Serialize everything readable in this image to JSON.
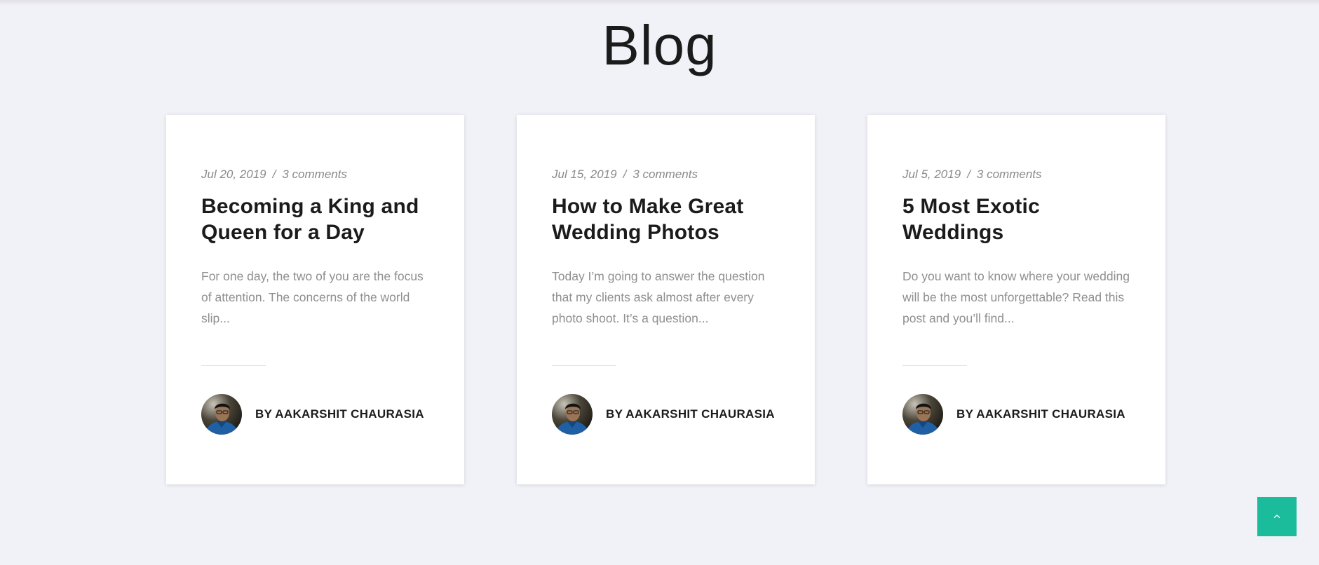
{
  "page": {
    "title": "Blog"
  },
  "posts": [
    {
      "date": "Jul 20, 2019",
      "separator": "/",
      "comments": "3 comments",
      "title": "Becoming a King and Queen for a Day",
      "excerpt": "For one day, the two of you are the focus of attention. The concerns of the world slip...",
      "author": "BY AAKARSHIT CHAURASIA"
    },
    {
      "date": "Jul 15, 2019",
      "separator": "/",
      "comments": "3 comments",
      "title": "How to Make Great Wedding Photos",
      "excerpt": "Today I’m going to answer the question that my clients ask almost after every photo shoot. It’s a question...",
      "author": "BY AAKARSHIT CHAURASIA"
    },
    {
      "date": "Jul 5, 2019",
      "separator": "/",
      "comments": "3 comments",
      "title": "5 Most Exotic Weddings",
      "excerpt": "Do you want to know where your wedding will be the most unforgettable? Read this post and you’ll find...",
      "author": "BY AAKARSHIT CHAURASIA"
    }
  ],
  "back_to_top": {
    "icon": "chevron-up-icon"
  },
  "colors": {
    "background": "#f1f2f7",
    "card": "#ffffff",
    "accent": "#1abc9c",
    "heading": "#1b1b1b",
    "muted": "#8f8f8f"
  }
}
